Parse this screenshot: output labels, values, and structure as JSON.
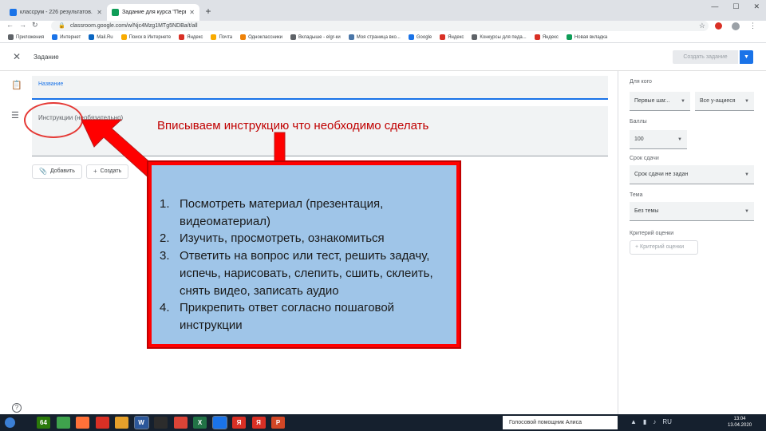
{
  "browser": {
    "tabs": [
      {
        "title": "классрум - 226 результатов. По",
        "favicon_color": "#1a73e8"
      },
      {
        "title": "Задание для курса \"Первые ша",
        "favicon_color": "#0f9d58"
      }
    ],
    "new_tab_symbol": "+",
    "url": "classroom.google.com/w/Njc4Mzg1MTg5NDBa/t/all",
    "bookmarks": [
      {
        "label": "Приложения",
        "color": "#5f6368"
      },
      {
        "label": "Интернет",
        "color": "#1a73e8"
      },
      {
        "label": "Mail.Ru",
        "color": "#0a66c2"
      },
      {
        "label": "Поиск в Интернете",
        "color": "#f9ab00"
      },
      {
        "label": "Яндекс",
        "color": "#d93025"
      },
      {
        "label": "Почта",
        "color": "#f9ab00"
      },
      {
        "label": "Одноклассники",
        "color": "#ee8208"
      },
      {
        "label": "Вкладыше - elgr-ки",
        "color": "#5f6368"
      },
      {
        "label": "Моя страница вко...",
        "color": "#4a76a8"
      },
      {
        "label": "Google",
        "color": "#1a73e8"
      },
      {
        "label": "Яндекс",
        "color": "#d93025"
      },
      {
        "label": "Конкурсы для педа...",
        "color": "#5f6368"
      },
      {
        "label": "Яндекс",
        "color": "#d93025"
      },
      {
        "label": "Новая вкладка",
        "color": "#0f9d58"
      }
    ]
  },
  "page": {
    "title": "Задание",
    "create_button": "Создать задание",
    "form": {
      "title_label": "Название",
      "instructions_label": "Инструкции (необязательно)"
    },
    "add_button": "Добавить",
    "create_chip": "Создать",
    "help_symbol": "?"
  },
  "sidebar": {
    "for_whom_label": "Для кого",
    "course_value": "Первые шаг...",
    "students_value": "Все у-ащиеся",
    "points_label": "Баллы",
    "points_value": "100",
    "due_label": "Срок сдачи",
    "due_value": "Срок сдачи не задан",
    "topic_label": "Тема",
    "topic_value": "Без темы",
    "rubric_label": "Критерий оценки",
    "rubric_button": "+ Критерий оценки"
  },
  "annotation": {
    "caption": "Вписываем инструкцию что необходимо сделать",
    "steps": [
      {
        "num": "1.",
        "text": "Посмотреть материал (презентация, видеоматериал)"
      },
      {
        "num": "2.",
        "text": "Изучить, просмотреть, ознакомиться"
      },
      {
        "num": "3.",
        "text": "Ответить на вопрос или тест, решить задачу, испечь, нарисовать, слепить, сшить, склеить, снять видео, записать аудио"
      },
      {
        "num": "4.",
        "text": "Прикрепить ответ согласно пошаговой инструкции"
      }
    ]
  },
  "taskbar": {
    "apps": [
      {
        "name": "64",
        "color": "#2b7a0b"
      },
      {
        "name": "",
        "color": "#3fa34d"
      },
      {
        "name": "",
        "color": "#ff7139"
      },
      {
        "name": "",
        "color": "#d93025"
      },
      {
        "name": "",
        "color": "#e6a12b"
      },
      {
        "name": "W",
        "color": "#2b579a"
      },
      {
        "name": "",
        "color": "#2c2c2c"
      },
      {
        "name": "",
        "color": "#db4437"
      },
      {
        "name": "X",
        "color": "#217346"
      },
      {
        "name": "",
        "color": "#1a73e8"
      },
      {
        "name": "Я",
        "color": "#d93025"
      },
      {
        "name": "Я",
        "color": "#d93025"
      },
      {
        "name": "P",
        "color": "#d24726"
      }
    ],
    "voice_assistant": "Голосовой помощник Алиса",
    "time": "13:04",
    "date": "13.04.2020"
  }
}
